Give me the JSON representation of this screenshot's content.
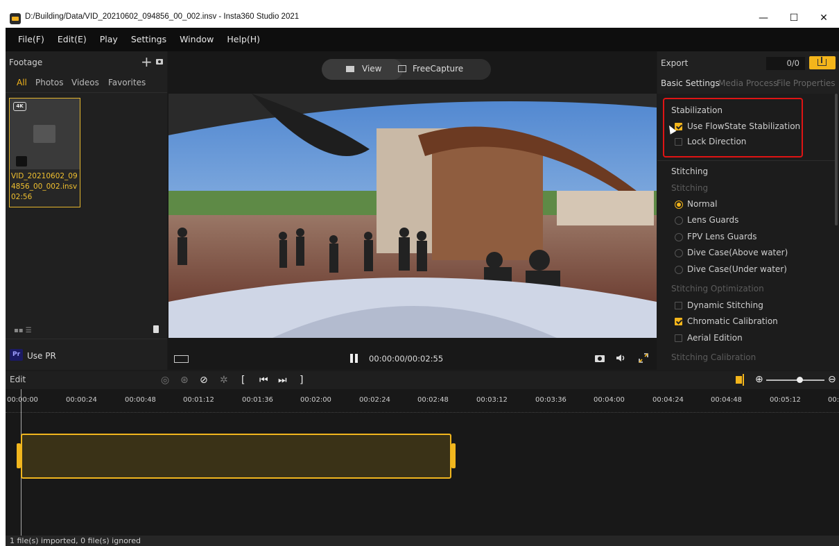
{
  "window": {
    "title": "D:/Building/Data/VID_20210602_094856_00_002.insv - Insta360 Studio 2021",
    "minimize": "—",
    "maximize": "☐",
    "close": "✕"
  },
  "menu": [
    "File(F)",
    "Edit(E)",
    "Play",
    "Settings",
    "Window",
    "Help(H)"
  ],
  "footage": {
    "label": "Footage",
    "add_icon": "+",
    "tabs": [
      "All",
      "Photos",
      "Videos",
      "Favorites"
    ],
    "active_tab": "All",
    "clip_name": "VID_20210602_094856_00_002.insv",
    "clip_duration": "02:56",
    "badge": "4K",
    "use_pr": "Use PR",
    "pr_icon": "Pr"
  },
  "viewer": {
    "view_label": "View",
    "freecapture_label": "FreeCapture",
    "timecode": "00:00:00/00:02:55"
  },
  "export": {
    "label": "Export",
    "count": "0/0",
    "tabs": [
      "Basic Settings",
      "Media Process",
      "File Properties"
    ],
    "active_tab": "Basic Settings",
    "stabilization": {
      "title": "Stabilization",
      "options": [
        {
          "label": "Use FlowState Stabilization",
          "checked": true
        },
        {
          "label": "Lock Direction",
          "checked": false
        }
      ]
    },
    "stitching": {
      "title": "Stitching",
      "sub": "Stitching",
      "options": [
        {
          "label": "Normal",
          "selected": true
        },
        {
          "label": "Lens Guards",
          "selected": false
        },
        {
          "label": "FPV Lens Guards",
          "selected": false
        },
        {
          "label": "Dive Case(Above water)",
          "selected": false
        },
        {
          "label": "Dive Case(Under water)",
          "selected": false
        }
      ]
    },
    "optimization": {
      "sub": "Stitching Optimization",
      "options": [
        {
          "label": "Dynamic Stitching",
          "checked": false
        },
        {
          "label": "Chromatic Calibration",
          "checked": true
        },
        {
          "label": "Aerial Edition",
          "checked": false
        }
      ]
    },
    "calibration_sub": "Stitching Calibration"
  },
  "edit": {
    "label": "Edit",
    "ticks": [
      "00:00:00",
      "00:00:24",
      "00:00:48",
      "00:01:12",
      "00:01:36",
      "00:02:00",
      "00:02:24",
      "00:02:48",
      "00:03:12",
      "00:03:36",
      "00:04:00",
      "00:04:24",
      "00:04:48",
      "00:05:12",
      "00:0"
    ]
  },
  "status": "1 file(s) imported, 0 file(s) ignored",
  "colors": {
    "accent": "#f3b51b",
    "highlight_box": "#e01414"
  }
}
